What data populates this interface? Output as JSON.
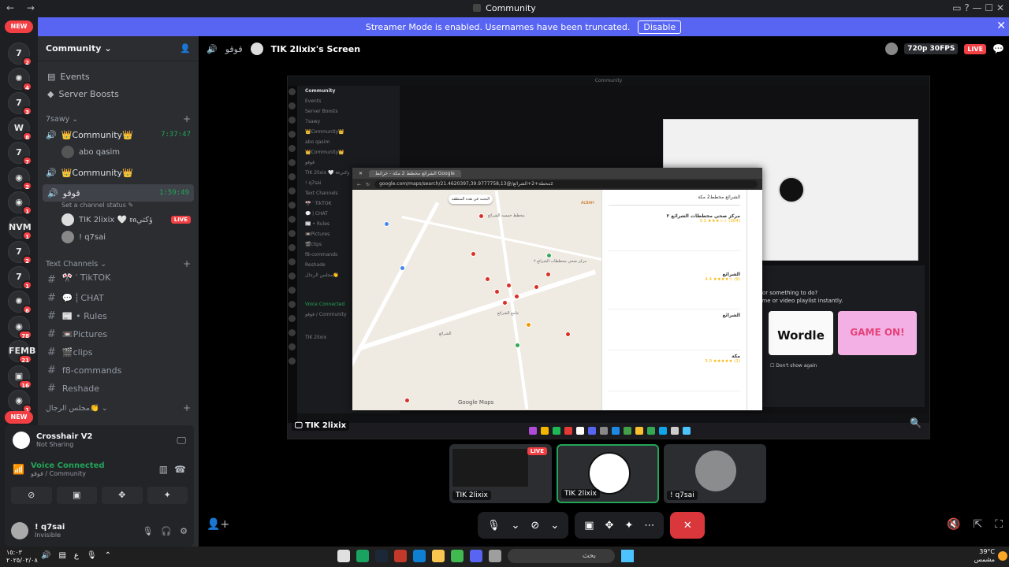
{
  "window": {
    "title": "Community",
    "nav": "← →",
    "controls": "▭ ? — ☐ ✕"
  },
  "banner": {
    "text": "Streamer Mode is enabled. Usernames have been truncated.",
    "disable_label": "Disable",
    "close": "✕"
  },
  "guilds": {
    "new_label": "NEW",
    "items": [
      {
        "glyph": "7",
        "badge": "2"
      },
      {
        "glyph": "✺",
        "badge": "4"
      },
      {
        "glyph": "7",
        "badge": "3"
      },
      {
        "glyph": "W",
        "badge": "8"
      },
      {
        "glyph": "7",
        "badge": "7"
      },
      {
        "glyph": "◉",
        "badge": "2"
      },
      {
        "glyph": "◉",
        "badge": "1"
      },
      {
        "glyph": "NVM",
        "badge": "1"
      },
      {
        "glyph": "7",
        "badge": "2"
      },
      {
        "glyph": "7",
        "badge": "1"
      },
      {
        "glyph": "✺",
        "badge": "6"
      },
      {
        "glyph": "◉",
        "badge": "78"
      },
      {
        "glyph": "FEMB",
        "badge": "21"
      },
      {
        "glyph": "▣",
        "badge": "16"
      },
      {
        "glyph": "◉",
        "badge": "1"
      }
    ]
  },
  "sidebar": {
    "server_name": "Community",
    "chevron": "⌄",
    "menu": [
      {
        "icon": "▤",
        "label": "Events"
      },
      {
        "icon": "◆",
        "label": "Server Boosts"
      }
    ],
    "cat_voice": "7sawy",
    "voice_channels": [
      {
        "name": "👑Community👑",
        "time": "7:37:47"
      },
      {
        "name": "👑Community👑",
        "time": ""
      },
      {
        "name": "قوقو",
        "time": "1:59:49"
      }
    ],
    "users_ch1": [
      "abo qasim"
    ],
    "status_text": "Set a channel status ✎",
    "users_ch3": [
      "TIK 2lixix 🤍 𝖗𝖆ؤكتي",
      "! q7sai"
    ],
    "live_label": "LIVE",
    "cat_text": "Text Channels",
    "text_channels": [
      "🎌 ་ TikTOK",
      "💬 ⸽ CHAT",
      "📰 • Rules",
      "📼Pictures",
      "🎬clips",
      "f8-commands",
      "Reshade"
    ],
    "cat_more": "مجلس الرجال👏"
  },
  "voice_panel": {
    "app_name": "Crosshair V2",
    "app_status": "Not Sharing",
    "connected": "Voice Connected",
    "connected_sub": "قوقو / Community",
    "user_name": "! q7sai",
    "user_status": "Invisible"
  },
  "stage": {
    "channel": "قوقو",
    "screen_title": "TIK 2lixix's Screen",
    "quality": "720p 30FPS",
    "live": "LIVE",
    "screen_label": "TIK 2lixix",
    "shared": {
      "window_title": "Community",
      "browser_url": "google.com/maps/search/محطة+2+الشرائع/@21.4620397,39.9777758,13z",
      "tab_title": "الشرائع مخطط 2 مكة - خرائط Google",
      "map_search": "البحث في هذه المنطقة",
      "map_credit": "Google Maps",
      "results_query": "الشرائع مخطط2 مكة",
      "result1_title": "مركز صحي مخططات الشرائع ٢",
      "result1_rating": "3.2 ★★★☆☆ (304)",
      "result2_title": "الشرائع",
      "result2_rating": "4.4 ★★★★☆ (9)",
      "result3_title": "الشرائع",
      "result4_title": "مكة",
      "result4_rating": "5.0 ★★★★★ (1)",
      "promo_text": "Looking for something to do?\nPick a game or video playlist instantly.",
      "wordle": "Wordle",
      "game_on": "GAME ON!",
      "dont_show": "Don't show again",
      "map_labels": [
        "مخطط خمسه الشرائع",
        "مركز صحي مخططات الشرائع ٢",
        "جامع الشرائع",
        "الشرائع",
        "ALBAH"
      ]
    },
    "tiles": [
      {
        "name": "TIK 2lixix",
        "live": "LIVE"
      },
      {
        "name": "TIK 2lixix"
      },
      {
        "name": "! q7sai"
      }
    ]
  },
  "taskbar": {
    "time": "١٥:٠٣",
    "date": "٢٠٢٥/٠٢/٠٨",
    "search": "بحث",
    "weather": "39°C",
    "weather_sub": "مشمس"
  }
}
